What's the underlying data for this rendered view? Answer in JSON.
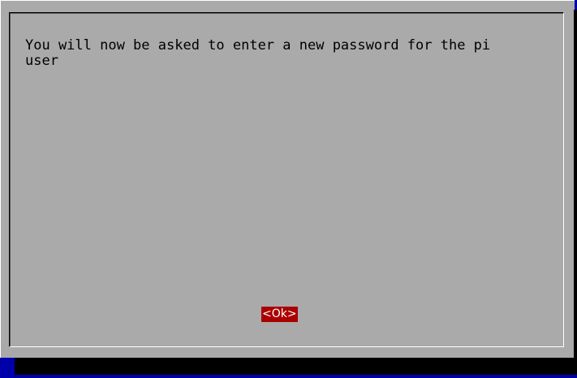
{
  "dialog": {
    "message": "You will now be asked to enter a new password for the pi\nuser",
    "ok_label": "<Ok>"
  },
  "colors": {
    "background": "#0000aa",
    "dialog": "#aaaaaa",
    "button_selected": "#aa0000",
    "shadow": "#000000"
  }
}
